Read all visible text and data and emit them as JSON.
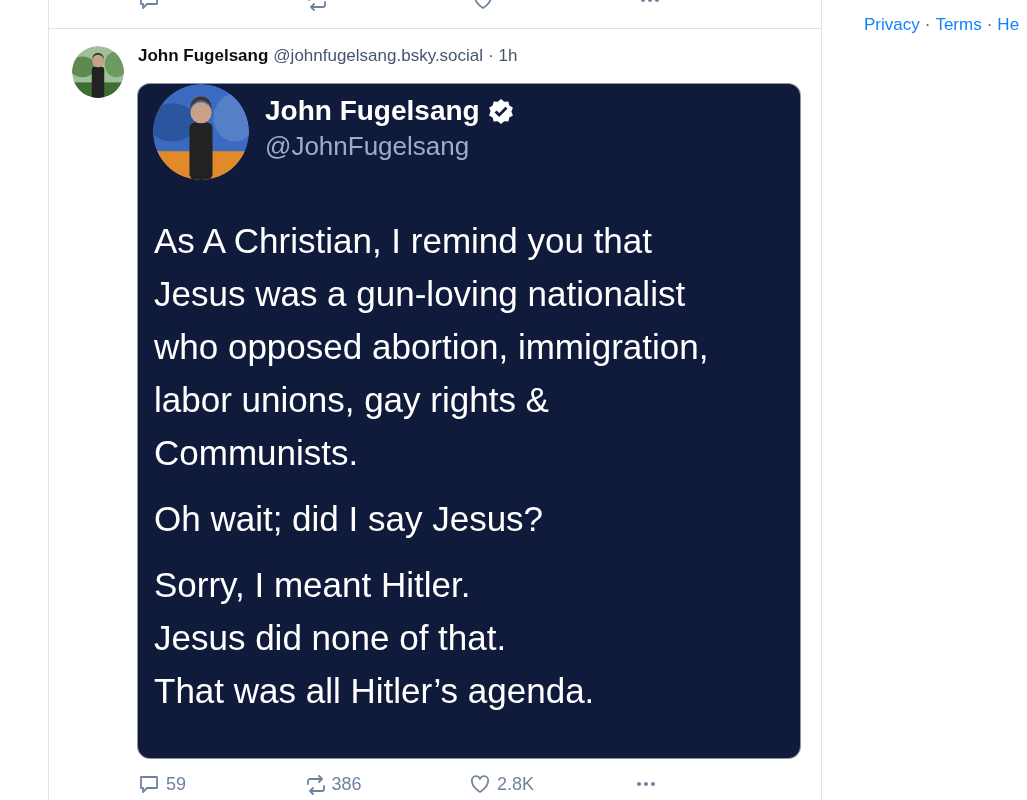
{
  "feed_top": {
    "actions": [
      {
        "kind": "reply"
      },
      {
        "kind": "repost"
      },
      {
        "kind": "like"
      },
      {
        "kind": "more"
      }
    ]
  },
  "post": {
    "author": {
      "name": "John Fugelsang",
      "handle": "@johnfugelsang.bsky.social",
      "time": "· 1h"
    },
    "embed": {
      "author": {
        "name": "John Fugelsang",
        "verified": true,
        "handle": "@JohnFugelsang"
      },
      "paragraphs": [
        "As A Christian, I remind you that\nJesus was a gun-loving nationalist\nwho opposed abortion, immigration,\nlabor unions, gay rights &\nCommunists.",
        "Oh wait; did I say Jesus?",
        "Sorry, I meant Hitler.\nJesus did none of that.\nThat was all Hitler’s agenda."
      ]
    },
    "actions": [
      {
        "kind": "reply",
        "count": "59"
      },
      {
        "kind": "repost",
        "count": "386"
      },
      {
        "kind": "like",
        "count": "2.8K"
      },
      {
        "kind": "more"
      }
    ]
  },
  "footer": {
    "links": [
      "Privacy",
      "Terms",
      "He"
    ],
    "separator": "·"
  }
}
